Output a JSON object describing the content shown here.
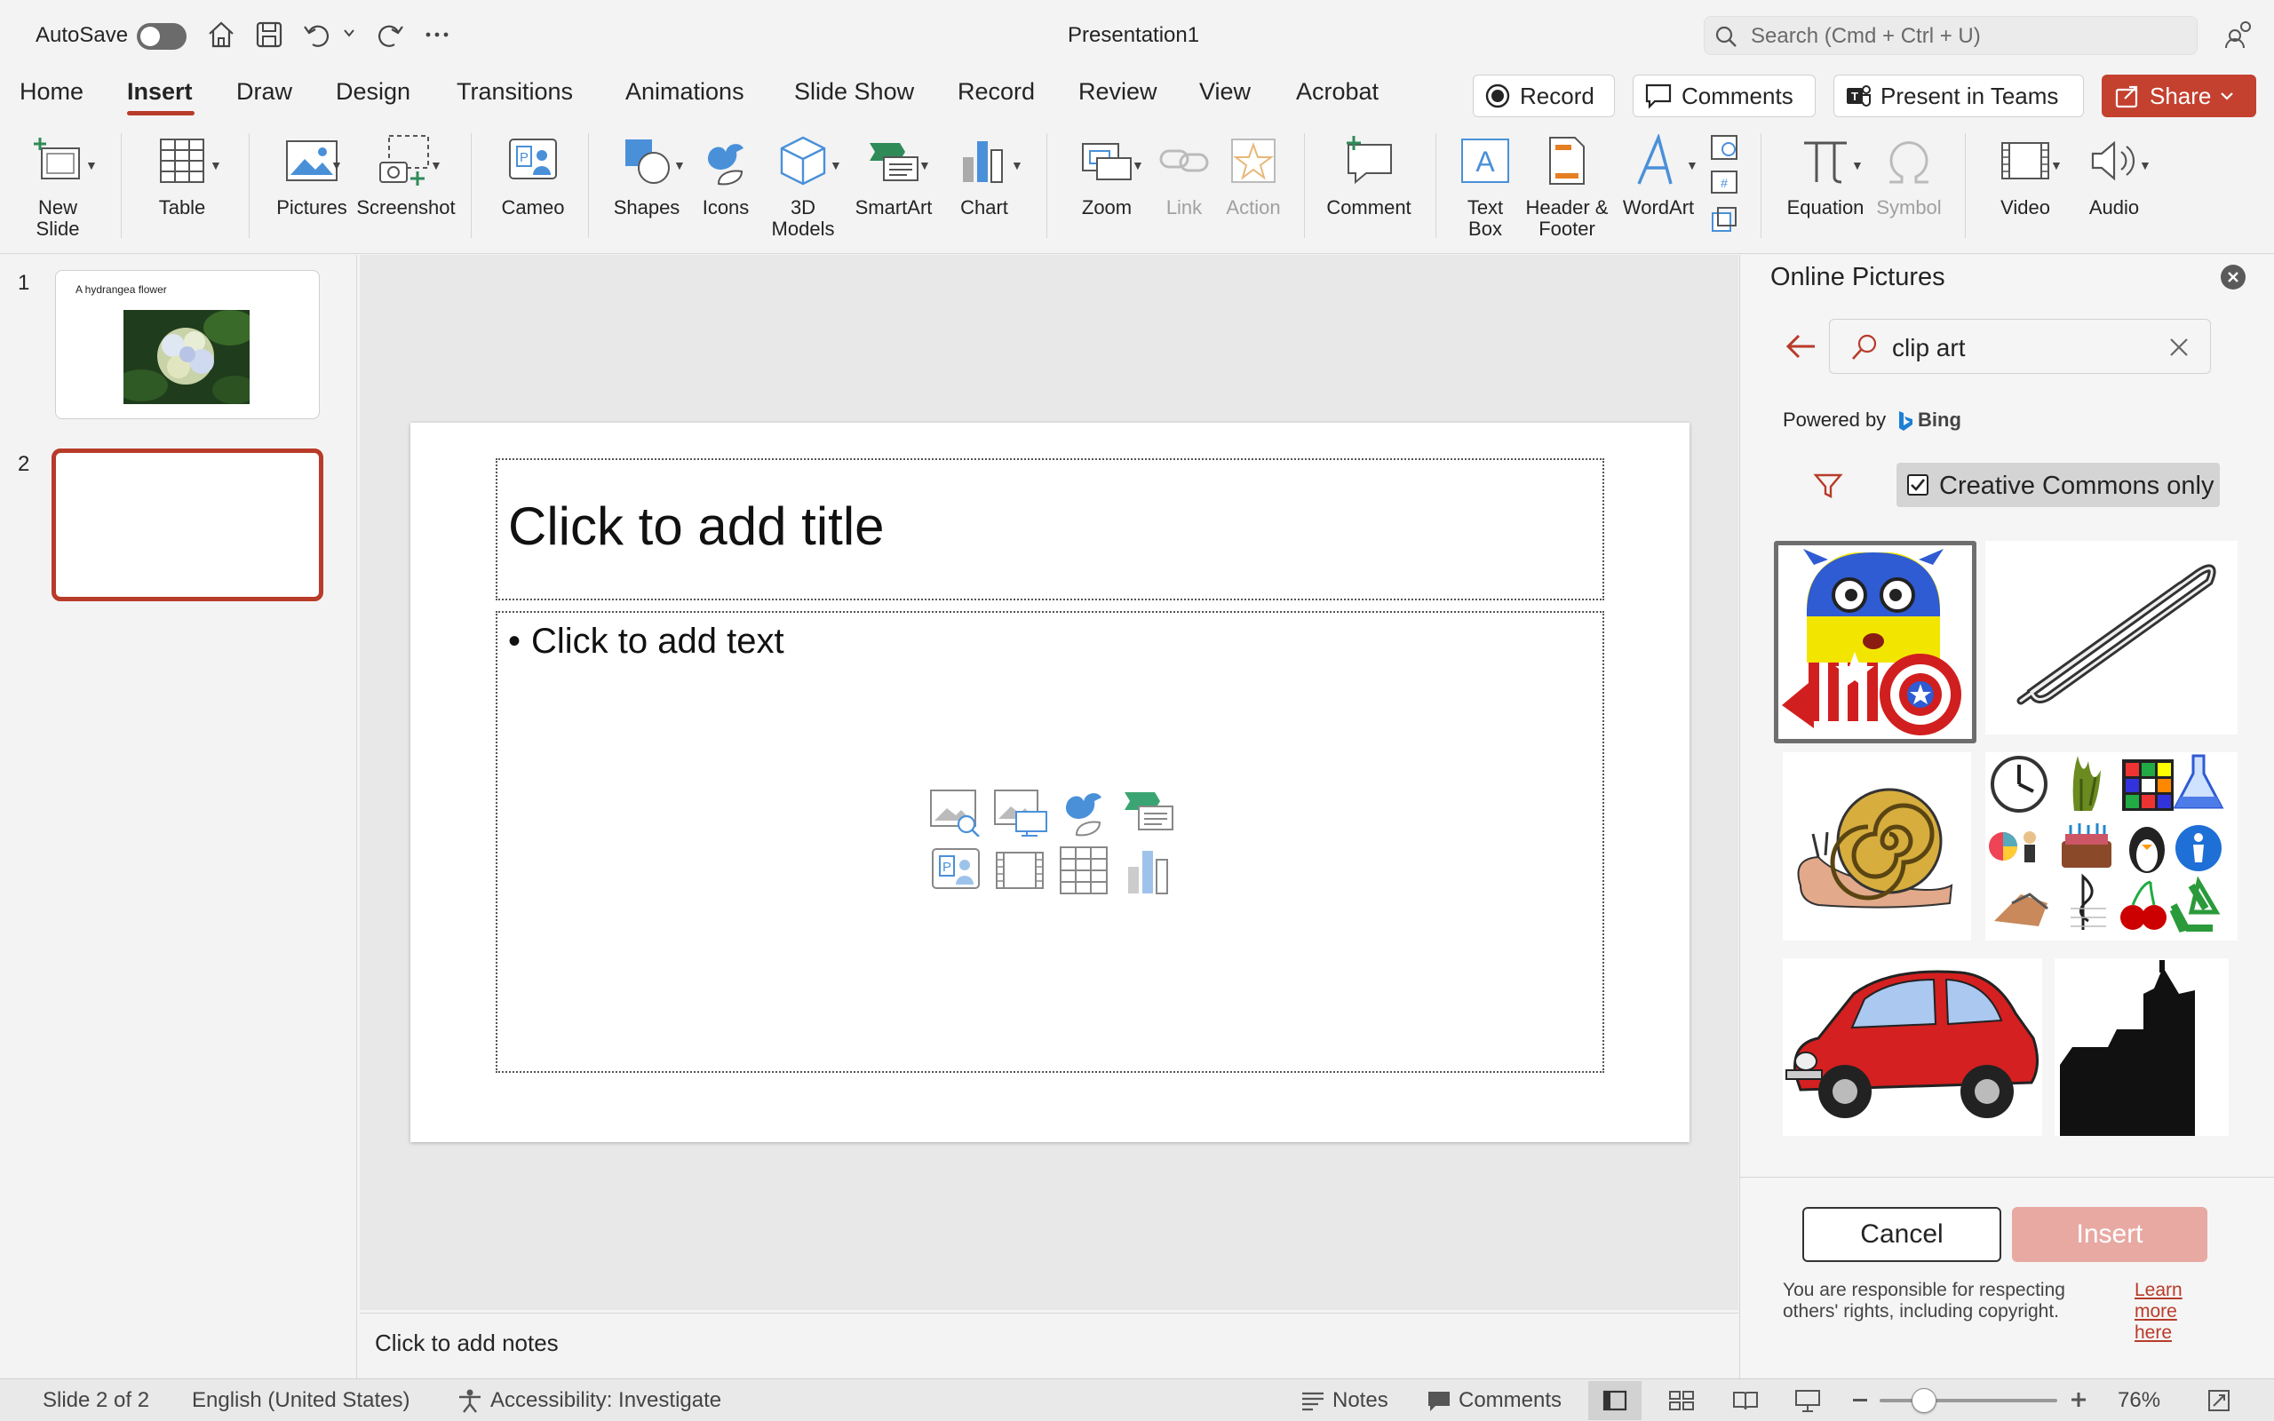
{
  "titlebar": {
    "autosave_label": "AutoSave",
    "doc_title": "Presentation1",
    "search_placeholder": "Search (Cmd + Ctrl + U)"
  },
  "tabs": [
    "Home",
    "Insert",
    "Draw",
    "Design",
    "Transitions",
    "Animations",
    "Slide Show",
    "Record",
    "Review",
    "View",
    "Acrobat"
  ],
  "active_tab": "Insert",
  "top_buttons": {
    "record": "Record",
    "comments": "Comments",
    "present": "Present in Teams",
    "share": "Share"
  },
  "ribbon": {
    "new_slide": [
      "New",
      "Slide"
    ],
    "table": "Table",
    "pictures": "Pictures",
    "screenshot": "Screenshot",
    "cameo": "Cameo",
    "shapes": "Shapes",
    "icons": "Icons",
    "models": [
      "3D",
      "Models"
    ],
    "smartart": "SmartArt",
    "chart": "Chart",
    "zoom": "Zoom",
    "link": "Link",
    "action": "Action",
    "comment": "Comment",
    "textbox": [
      "Text",
      "Box"
    ],
    "header_footer": [
      "Header &",
      "Footer"
    ],
    "wordart": "WordArt",
    "equation": "Equation",
    "symbol": "Symbol",
    "video": "Video",
    "audio": "Audio"
  },
  "thumbnails": [
    {
      "num": "1",
      "title": "A hydrangea flower"
    },
    {
      "num": "2",
      "title": ""
    }
  ],
  "slide": {
    "title_placeholder": "Click to add title",
    "body_placeholder": "Click to add text"
  },
  "notes_placeholder": "Click to add notes",
  "pane": {
    "title": "Online Pictures",
    "search_value": "clip art",
    "powered_by": "Powered by",
    "bing": "Bing",
    "filter_label": "Creative Commons only",
    "filter_checked": true,
    "cancel": "Cancel",
    "insert": "Insert",
    "disclaimer": "You are responsible for respecting others' rights, including copyright.",
    "learn_more": [
      "Learn",
      "more",
      "here"
    ],
    "results": [
      "minion-captain-america-clipart",
      "paperclip-clipart",
      "snail-clipart",
      "clipart-collage",
      "red-car-clipart",
      "castle-silhouette-clipart"
    ]
  },
  "status": {
    "slide_of": "Slide 2 of 2",
    "language": "English (United States)",
    "accessibility": "Accessibility: Investigate",
    "notes": "Notes",
    "comments": "Comments",
    "zoom": "76%",
    "zoom_level": 0.76
  },
  "colors": {
    "accent": "#b83b29",
    "share": "#c4402f",
    "insert_disabled": "#e8a9a3"
  }
}
